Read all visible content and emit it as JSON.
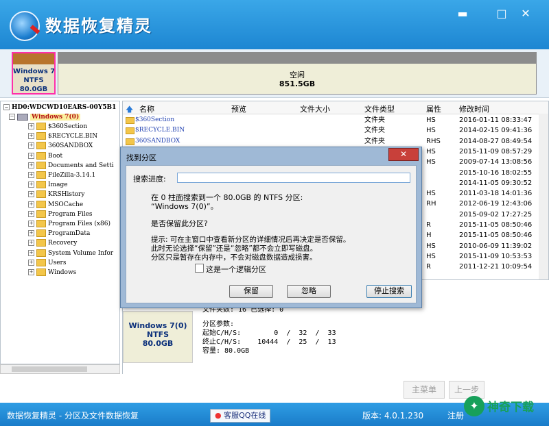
{
  "app": {
    "title": "数据恢复精灵",
    "min_icon": "▬",
    "max_icon": "□",
    "close_icon": "✕"
  },
  "disk_bar": {
    "partition1": {
      "name": "Windows 7(0)",
      "fs": "NTFS",
      "size": "80.0GB"
    },
    "partition2": {
      "name": "空闲",
      "size": "851.5GB"
    }
  },
  "tree": {
    "disk": "HD0:WDCWD10EARS-00Y5B1",
    "partition": "Windows 7(0)",
    "folders": [
      "$360Section",
      "$RECYCLE.BIN",
      "360SANDBOX",
      "Boot",
      "Documents and Setti",
      "FileZilla-3.14.1",
      "Image",
      "KRSHistory",
      "MSOCache",
      "Program Files",
      "Program Files (x86)",
      "ProgramData",
      "Recovery",
      "System Volume Infor",
      "Users",
      "Windows"
    ]
  },
  "file_list": {
    "columns": [
      "名称",
      "预览",
      "文件大小",
      "文件类型",
      "属性",
      "修改时间"
    ],
    "rows": [
      {
        "name": "$360Section",
        "type": "文件夹",
        "attr": "HS",
        "time": "2016-01-11 08:33:47"
      },
      {
        "name": "$RECYCLE.BIN",
        "type": "文件夹",
        "attr": "HS",
        "time": "2014-02-15 09:41:36"
      },
      {
        "name": "360SANDBOX",
        "type": "文件夹",
        "attr": "RHS",
        "time": "2014-08-27 08:49:54"
      },
      {
        "name": "",
        "type": "",
        "attr": "HS",
        "time": "2015-11-09 08:57:29"
      },
      {
        "name": "",
        "type": "",
        "attr": "HS",
        "time": "2009-07-14 13:08:56"
      },
      {
        "name": "",
        "type": "",
        "attr": "",
        "time": "2015-10-16 18:02:55"
      },
      {
        "name": "",
        "type": "",
        "attr": "",
        "time": "2014-11-05 09:30:52"
      },
      {
        "name": "",
        "type": "",
        "attr": "HS",
        "time": "2011-03-18 14:01:36"
      },
      {
        "name": "",
        "type": "",
        "attr": "RH",
        "time": "2012-06-19 12:43:06"
      },
      {
        "name": "",
        "type": "",
        "attr": "",
        "time": "2015-09-02 17:27:25"
      },
      {
        "name": "",
        "type": "",
        "attr": "R",
        "time": "2015-11-05 08:50:46"
      },
      {
        "name": "",
        "type": "",
        "attr": "H",
        "time": "2015-11-05 08:50:46"
      },
      {
        "name": "",
        "type": "",
        "attr": "HS",
        "time": "2010-06-09 11:39:02"
      },
      {
        "name": "",
        "type": "",
        "attr": "HS",
        "time": "2015-11-09 10:53:53"
      },
      {
        "name": "",
        "type": "",
        "attr": "R",
        "time": "2011-12-21 10:09:54"
      }
    ]
  },
  "info_panel": {
    "partition": {
      "name": "Windows 7(0)",
      "fs": "NTFS",
      "size": "80.0GB"
    },
    "selected_line": "文件夹数: 16 已选择: 0",
    "params_label": "分区参数:",
    "start_chs": "起始C/H/S:        0  /  32  /  33",
    "end_chs": "终止C/H/S:    10444  /  25  /  13",
    "capacity": "容量: 80.0GB"
  },
  "dialog": {
    "title": "找到分区",
    "close_label": "✕",
    "search_label": "搜索进度:",
    "line1": "在 0 柱面搜索到一个 80.0GB 的 NTFS 分区:",
    "line2": "“Windows 7(0)”。",
    "question": "是否保留此分区?",
    "tip1": "提示: 可在主窗口中查看新分区的详细情况后再决定是否保留。",
    "tip2": "此时无论选择“保留”还是“忽略”都不会立即写磁盘。",
    "tip3": "分区只是暂存在内存中，不会对磁盘数据造成损害。",
    "checkbox_label": "这是一个逻辑分区",
    "btn_keep": "保留",
    "btn_ignore": "忽略",
    "btn_stop": "停止搜索"
  },
  "nav": {
    "main_menu": "主菜单",
    "prev": "上一步"
  },
  "status": {
    "left": "数据恢复精灵 - 分区及文件数据恢复",
    "qq": "客服QQ在线",
    "version": "版本: 4.0.1.230",
    "register": "注册"
  },
  "watermark": {
    "logo": "✦",
    "text": "神奇下载"
  }
}
